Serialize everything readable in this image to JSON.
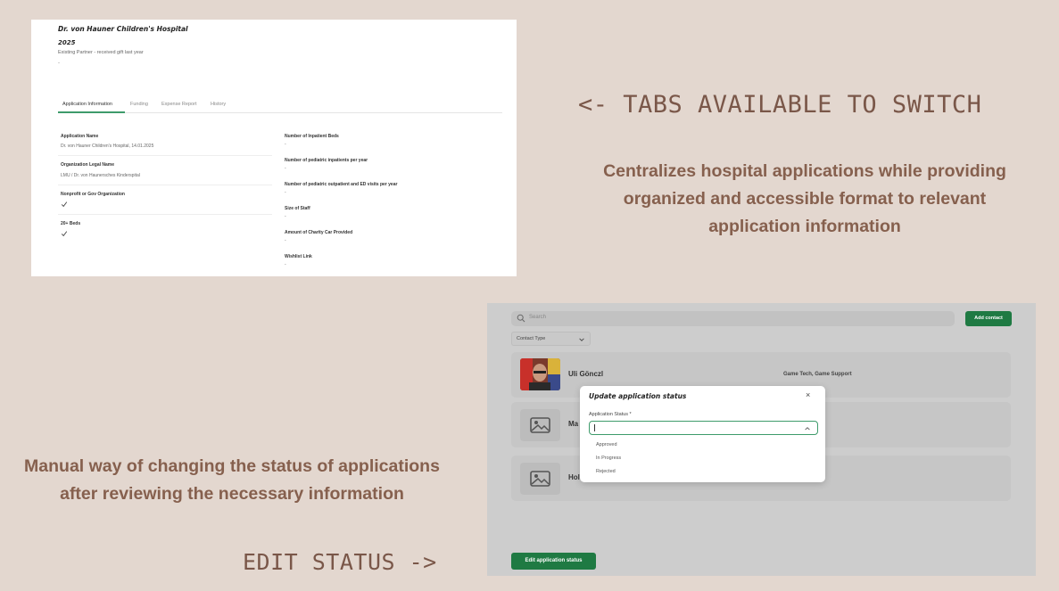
{
  "screenshot1": {
    "title": "Dr. von Hauner Children's Hospital",
    "year": "2025",
    "subtitle": "Existing Partner - received gift last year",
    "dash": "-",
    "tabs": [
      {
        "label": "Application Information",
        "active": true
      },
      {
        "label": "Funding",
        "active": false
      },
      {
        "label": "Expense Report",
        "active": false
      },
      {
        "label": "History",
        "active": false
      }
    ],
    "left_fields": [
      {
        "label": "Application Name",
        "value": "Dr. von Hauner Children's Hospital, 14.01.2025"
      },
      {
        "label": "Organization Legal Name",
        "value": "LMU / Dr. von Haunersches Kinderspital"
      },
      {
        "label": "Nonprofit or Gov Organization",
        "value": "check-icon"
      },
      {
        "label": "20+ Beds",
        "value": "check-icon"
      }
    ],
    "right_fields": [
      {
        "label": "Number of Inpatient Beds",
        "value": "-"
      },
      {
        "label": "Number of pediatric inpatients per year",
        "value": "-"
      },
      {
        "label": "Number of pediatric outpatient and ED visits per year",
        "value": "-"
      },
      {
        "label": "Size of Staff",
        "value": "-"
      },
      {
        "label": "Amount of Charity Car Provided",
        "value": "-"
      },
      {
        "label": "Wishlist Link",
        "value": "-"
      }
    ],
    "accent_color": "#3e9b6b"
  },
  "annotations": {
    "tabs_note": "<- TABS AVAILABLE TO SWITCH",
    "tabs_desc": "Centralizes hospital applications while providing organized and accessible format to relevant application information",
    "status_desc": "Manual way of changing the status of applications after reviewing the necessary information",
    "edit_note": "EDIT STATUS ->"
  },
  "screenshot2": {
    "search_placeholder": "Search",
    "add_contact_label": "Add contact",
    "contact_type_label": "Contact Type",
    "contacts": [
      {
        "name": "Uli Gönczl",
        "tags": "Game Tech, Game Support",
        "avatar": "photo"
      },
      {
        "name": "Ma",
        "tags": "",
        "avatar": "image-placeholder-icon"
      },
      {
        "name": "Holly",
        "tags": "",
        "avatar": "image-placeholder-icon"
      }
    ],
    "edit_button_label": "Edit application status",
    "modal": {
      "title": "Update application status",
      "close": "×",
      "field_label": "Application Status *",
      "options": [
        "Approved",
        "In Progress",
        "Rejected"
      ]
    },
    "button_color": "#1f7a43"
  }
}
